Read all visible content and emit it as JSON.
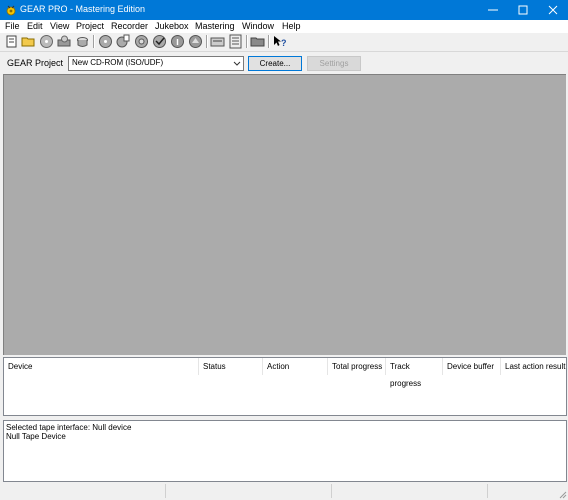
{
  "window": {
    "title": "GEAR PRO - Mastering Edition"
  },
  "menu": [
    "File",
    "Edit",
    "View",
    "Project",
    "Recorder",
    "Jukebox",
    "Mastering",
    "Window",
    "Help"
  ],
  "toolbar": {
    "icons": [
      "new-document-icon",
      "open-folder-icon",
      "disc-icon",
      "open-disc-icon",
      "recorder-icon",
      "cd-icon",
      "cd-copy-icon",
      "cd-settings-icon",
      "cd-verify-icon",
      "cd-info-icon",
      "cd-eject-icon",
      "device-icon",
      "properties-icon",
      "folder-icon",
      "help-icon"
    ]
  },
  "project": {
    "label": "GEAR Project",
    "select_value": "New CD-ROM (ISO/UDF)",
    "create_label": "Create...",
    "settings_label": "Settings"
  },
  "device_table": {
    "columns": [
      "Device",
      "Status",
      "Action",
      "Total progress",
      "Track progress",
      "Device buffer",
      "Last action result"
    ]
  },
  "log": {
    "lines": [
      "Selected tape interface: Null device",
      "Null Tape Device"
    ]
  },
  "colors": {
    "titlebar": "#0078d7",
    "workspace": "#ababab"
  }
}
